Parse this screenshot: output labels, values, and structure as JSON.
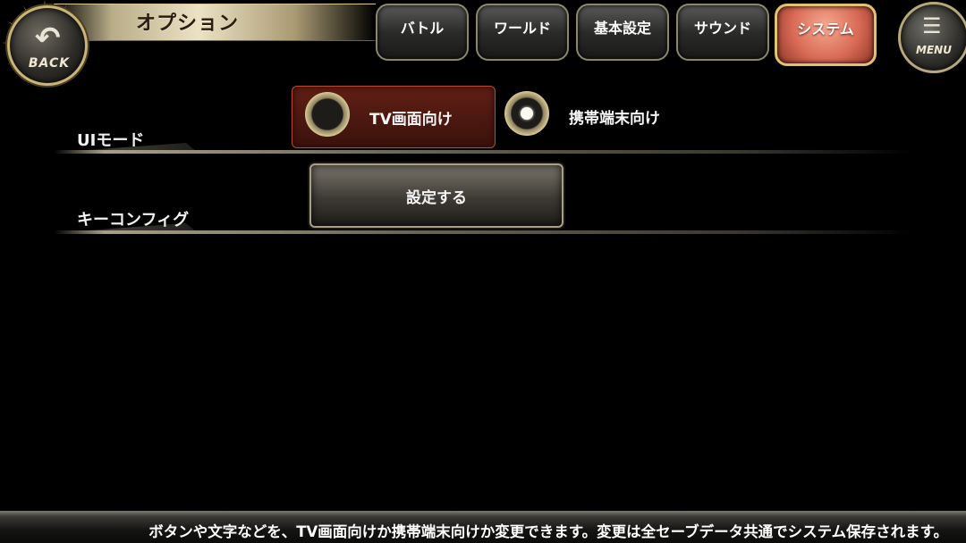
{
  "header": {
    "title": "オプション",
    "back_label": "BACK",
    "menu_label": "MENU",
    "tabs": [
      {
        "label": "バトル",
        "active": false
      },
      {
        "label": "ワールド",
        "active": false
      },
      {
        "label": "基本設定",
        "active": false
      },
      {
        "label": "サウンド",
        "active": false
      },
      {
        "label": "システム",
        "active": true
      }
    ],
    "accent_color": "#d86a55"
  },
  "settings": {
    "ui_mode": {
      "label": "UIモード",
      "options": [
        {
          "label": "TV画面向け",
          "selected": false
        },
        {
          "label": "携帯端末向け",
          "selected": true
        }
      ]
    },
    "key_config": {
      "label": "キーコンフィグ",
      "button_label": "設定する"
    }
  },
  "footer": {
    "help_text": "ボタンや文字などを、TV画面向けか携帯端末向けか変更できます。変更は全セーブデータ共通でシステム保存されます。"
  },
  "icons": {
    "back": "back-arrow-icon",
    "menu": "hamburger-menu-icon"
  }
}
